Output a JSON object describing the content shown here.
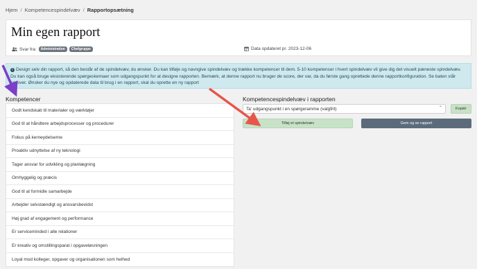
{
  "breadcrumb": {
    "items": [
      "Hjem",
      "Kompetencespindelvæv",
      "Rapportopsætning"
    ],
    "separator": "/"
  },
  "header": {
    "title": "Min egen rapport",
    "respondents_label": "Svar fra:",
    "badges": [
      "Administration",
      "Chefgruppe"
    ],
    "updated_label": "Data opdateret pr. 2023-12-06"
  },
  "info": {
    "text": "Design selv din rapport, så den består af de spindelvæv, du ønsker. Du kan tilføje og navngive spindelvæv og trække kompetencer til dem. 5-10 kompetencer i hvert spindelvæv vil give dig det visuelt pæneste spindelvæv. Du kan også bruge eksisterende spørgeskemaer som udgangspunkt for at designe rapporten. Bemærk, at denne rapport nu bruger de score, der var, da du første gang oprettede denne rapportkonfiguration. Se baten står herover. Ønsker du nye og opdaterede data til brug i en rapport, skal du oprette en ny rapport"
  },
  "competences": {
    "title": "Kompetencer",
    "items": [
      "Godt kendskab til materialer og værktøjer",
      "God til at håndtere arbejdsprocesser og procedurer",
      "Fokus på kerneydelserne",
      "Proaktiv udnyttelse af ny teknologi",
      "Tager ansvar for udvikling og planlægning",
      "Omhyggelig og præcis",
      "God til at formidle samarbejde",
      "Arbejder selvstændigt og ansvarsbevidst",
      "Høj grad af engagement og performance",
      "Er serviceminded i alle relationer",
      "Er kreativ og omstillingsparat i opgaveløsningen",
      "Loyal mod kolleger, opgaver og organisationen som helhed"
    ]
  },
  "report": {
    "title": "Kompetencespindelvæv i rapporten",
    "select_value": "Ta' udgangspunkt i en spørgeramme (valgfrit)",
    "copy_label": "Kopiér",
    "add_label": "Tilføj et spindelvæv",
    "save_label": "Gem og se rapport"
  },
  "colors": {
    "annotation_purple": "#7b3fc8",
    "annotation_red": "#e8564a",
    "info_bg": "#cfe9ef",
    "green_button": "#c7e2c7",
    "dark_button": "#5b6b7c"
  },
  "icons": {
    "users": "users-icon",
    "calendar": "calendar-icon",
    "info": "info-icon",
    "chevron": "chevron-down-icon"
  }
}
